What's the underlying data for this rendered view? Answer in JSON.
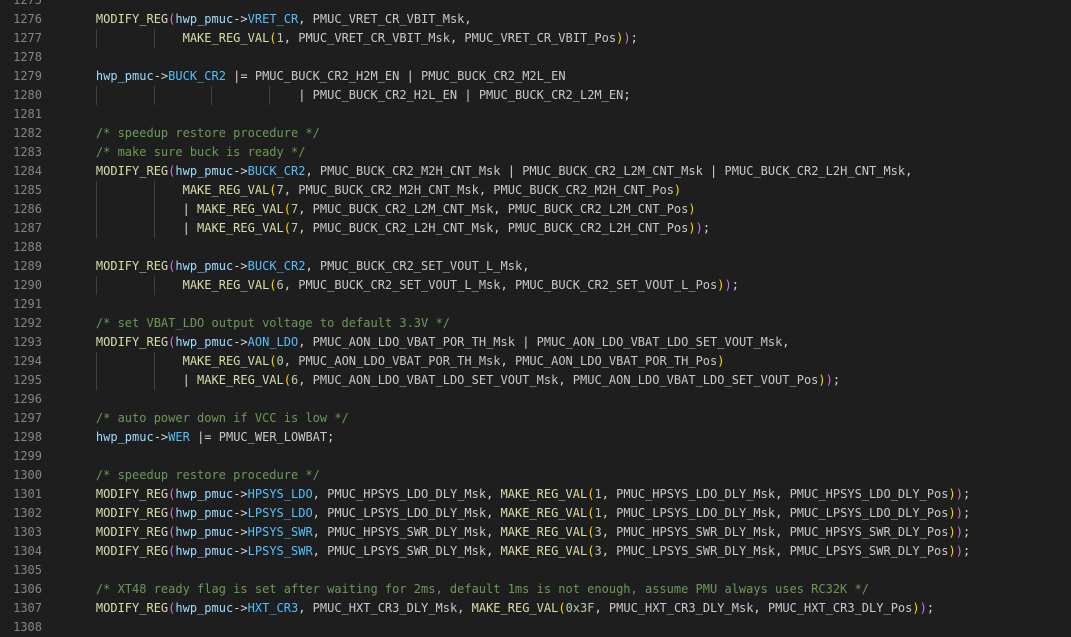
{
  "editor": {
    "lines": [
      {
        "no": "1275",
        "tokens": []
      },
      {
        "no": "1276",
        "tokens": [
          [
            "ws",
            "    "
          ],
          [
            "macro",
            "MODIFY_REG"
          ],
          [
            "p1",
            "("
          ],
          [
            "var",
            "hwp_pmuc"
          ],
          [
            "op",
            "->"
          ],
          [
            "field",
            "VRET_CR"
          ],
          [
            "op",
            ", "
          ],
          [
            "const",
            "PMUC_VRET_CR_VBIT_Msk"
          ],
          [
            "op",
            ","
          ]
        ]
      },
      {
        "no": "1277",
        "tokens": [
          [
            "ws",
            "                "
          ],
          [
            "macro",
            "MAKE_REG_VAL"
          ],
          [
            "p2",
            "("
          ],
          [
            "num",
            "1"
          ],
          [
            "op",
            ", "
          ],
          [
            "const",
            "PMUC_VRET_CR_VBIT_Msk"
          ],
          [
            "op",
            ", "
          ],
          [
            "const",
            "PMUC_VRET_CR_VBIT_Pos"
          ],
          [
            "p2",
            ")"
          ],
          [
            "p1",
            ")"
          ],
          [
            "op",
            ";"
          ]
        ]
      },
      {
        "no": "1278",
        "tokens": []
      },
      {
        "no": "1279",
        "tokens": [
          [
            "ws",
            "    "
          ],
          [
            "var",
            "hwp_pmuc"
          ],
          [
            "op",
            "->"
          ],
          [
            "field",
            "BUCK_CR2"
          ],
          [
            "op",
            " |= "
          ],
          [
            "const",
            "PMUC_BUCK_CR2_H2M_EN"
          ],
          [
            "op",
            " | "
          ],
          [
            "const",
            "PMUC_BUCK_CR2_M2L_EN"
          ]
        ]
      },
      {
        "no": "1280",
        "tokens": [
          [
            "ws",
            "                                "
          ],
          [
            "op",
            "| "
          ],
          [
            "const",
            "PMUC_BUCK_CR2_H2L_EN"
          ],
          [
            "op",
            " | "
          ],
          [
            "const",
            "PMUC_BUCK_CR2_L2M_EN"
          ],
          [
            "op",
            ";"
          ]
        ]
      },
      {
        "no": "1281",
        "tokens": []
      },
      {
        "no": "1282",
        "tokens": [
          [
            "ws",
            "    "
          ],
          [
            "comment",
            "/* speedup restore procedure */"
          ]
        ]
      },
      {
        "no": "1283",
        "tokens": [
          [
            "ws",
            "    "
          ],
          [
            "comment",
            "/* make sure buck is ready */"
          ]
        ]
      },
      {
        "no": "1284",
        "tokens": [
          [
            "ws",
            "    "
          ],
          [
            "macro",
            "MODIFY_REG"
          ],
          [
            "p1",
            "("
          ],
          [
            "var",
            "hwp_pmuc"
          ],
          [
            "op",
            "->"
          ],
          [
            "field",
            "BUCK_CR2"
          ],
          [
            "op",
            ", "
          ],
          [
            "const",
            "PMUC_BUCK_CR2_M2H_CNT_Msk"
          ],
          [
            "op",
            " | "
          ],
          [
            "const",
            "PMUC_BUCK_CR2_L2M_CNT_Msk"
          ],
          [
            "op",
            " | "
          ],
          [
            "const",
            "PMUC_BUCK_CR2_L2H_CNT_Msk"
          ],
          [
            "op",
            ","
          ]
        ]
      },
      {
        "no": "1285",
        "tokens": [
          [
            "ws",
            "                "
          ],
          [
            "macro",
            "MAKE_REG_VAL"
          ],
          [
            "p2",
            "("
          ],
          [
            "num",
            "7"
          ],
          [
            "op",
            ", "
          ],
          [
            "const",
            "PMUC_BUCK_CR2_M2H_CNT_Msk"
          ],
          [
            "op",
            ", "
          ],
          [
            "const",
            "PMUC_BUCK_CR2_M2H_CNT_Pos"
          ],
          [
            "p2",
            ")"
          ]
        ]
      },
      {
        "no": "1286",
        "tokens": [
          [
            "ws",
            "                "
          ],
          [
            "op",
            "| "
          ],
          [
            "macro",
            "MAKE_REG_VAL"
          ],
          [
            "p2",
            "("
          ],
          [
            "num",
            "7"
          ],
          [
            "op",
            ", "
          ],
          [
            "const",
            "PMUC_BUCK_CR2_L2M_CNT_Msk"
          ],
          [
            "op",
            ", "
          ],
          [
            "const",
            "PMUC_BUCK_CR2_L2M_CNT_Pos"
          ],
          [
            "p2",
            ")"
          ]
        ]
      },
      {
        "no": "1287",
        "tokens": [
          [
            "ws",
            "                "
          ],
          [
            "op",
            "| "
          ],
          [
            "macro",
            "MAKE_REG_VAL"
          ],
          [
            "p2",
            "("
          ],
          [
            "num",
            "7"
          ],
          [
            "op",
            ", "
          ],
          [
            "const",
            "PMUC_BUCK_CR2_L2H_CNT_Msk"
          ],
          [
            "op",
            ", "
          ],
          [
            "const",
            "PMUC_BUCK_CR2_L2H_CNT_Pos"
          ],
          [
            "p2",
            ")"
          ],
          [
            "p1",
            ")"
          ],
          [
            "op",
            ";"
          ]
        ]
      },
      {
        "no": "1288",
        "tokens": []
      },
      {
        "no": "1289",
        "tokens": [
          [
            "ws",
            "    "
          ],
          [
            "macro",
            "MODIFY_REG"
          ],
          [
            "p1",
            "("
          ],
          [
            "var",
            "hwp_pmuc"
          ],
          [
            "op",
            "->"
          ],
          [
            "field",
            "BUCK_CR2"
          ],
          [
            "op",
            ", "
          ],
          [
            "const",
            "PMUC_BUCK_CR2_SET_VOUT_L_Msk"
          ],
          [
            "op",
            ","
          ]
        ]
      },
      {
        "no": "1290",
        "tokens": [
          [
            "ws",
            "                "
          ],
          [
            "macro",
            "MAKE_REG_VAL"
          ],
          [
            "p2",
            "("
          ],
          [
            "num",
            "6"
          ],
          [
            "op",
            ", "
          ],
          [
            "const",
            "PMUC_BUCK_CR2_SET_VOUT_L_Msk"
          ],
          [
            "op",
            ", "
          ],
          [
            "const",
            "PMUC_BUCK_CR2_SET_VOUT_L_Pos"
          ],
          [
            "p2",
            ")"
          ],
          [
            "p1",
            ")"
          ],
          [
            "op",
            ";"
          ]
        ]
      },
      {
        "no": "1291",
        "tokens": []
      },
      {
        "no": "1292",
        "tokens": [
          [
            "ws",
            "    "
          ],
          [
            "comment",
            "/* set VBAT_LDO output voltage to default 3.3V */"
          ]
        ]
      },
      {
        "no": "1293",
        "tokens": [
          [
            "ws",
            "    "
          ],
          [
            "macro",
            "MODIFY_REG"
          ],
          [
            "p1",
            "("
          ],
          [
            "var",
            "hwp_pmuc"
          ],
          [
            "op",
            "->"
          ],
          [
            "field",
            "AON_LDO"
          ],
          [
            "op",
            ", "
          ],
          [
            "const",
            "PMUC_AON_LDO_VBAT_POR_TH_Msk"
          ],
          [
            "op",
            " | "
          ],
          [
            "const",
            "PMUC_AON_LDO_VBAT_LDO_SET_VOUT_Msk"
          ],
          [
            "op",
            ","
          ]
        ]
      },
      {
        "no": "1294",
        "tokens": [
          [
            "ws",
            "                "
          ],
          [
            "macro",
            "MAKE_REG_VAL"
          ],
          [
            "p2",
            "("
          ],
          [
            "num",
            "0"
          ],
          [
            "op",
            ", "
          ],
          [
            "const",
            "PMUC_AON_LDO_VBAT_POR_TH_Msk"
          ],
          [
            "op",
            ", "
          ],
          [
            "const",
            "PMUC_AON_LDO_VBAT_POR_TH_Pos"
          ],
          [
            "p2",
            ")"
          ]
        ]
      },
      {
        "no": "1295",
        "tokens": [
          [
            "ws",
            "                "
          ],
          [
            "op",
            "| "
          ],
          [
            "macro",
            "MAKE_REG_VAL"
          ],
          [
            "p2",
            "("
          ],
          [
            "num",
            "6"
          ],
          [
            "op",
            ", "
          ],
          [
            "const",
            "PMUC_AON_LDO_VBAT_LDO_SET_VOUT_Msk"
          ],
          [
            "op",
            ", "
          ],
          [
            "const",
            "PMUC_AON_LDO_VBAT_LDO_SET_VOUT_Pos"
          ],
          [
            "p2",
            ")"
          ],
          [
            "p1",
            ")"
          ],
          [
            "op",
            ";"
          ]
        ]
      },
      {
        "no": "1296",
        "tokens": []
      },
      {
        "no": "1297",
        "tokens": [
          [
            "ws",
            "    "
          ],
          [
            "comment",
            "/* auto power down if VCC is low */"
          ]
        ]
      },
      {
        "no": "1298",
        "tokens": [
          [
            "ws",
            "    "
          ],
          [
            "var",
            "hwp_pmuc"
          ],
          [
            "op",
            "->"
          ],
          [
            "field",
            "WER"
          ],
          [
            "op",
            " |= "
          ],
          [
            "const",
            "PMUC_WER_LOWBAT"
          ],
          [
            "op",
            ";"
          ]
        ]
      },
      {
        "no": "1299",
        "tokens": []
      },
      {
        "no": "1300",
        "tokens": [
          [
            "ws",
            "    "
          ],
          [
            "comment",
            "/* speedup restore procedure */"
          ]
        ]
      },
      {
        "no": "1301",
        "tokens": [
          [
            "ws",
            "    "
          ],
          [
            "macro",
            "MODIFY_REG"
          ],
          [
            "p1",
            "("
          ],
          [
            "var",
            "hwp_pmuc"
          ],
          [
            "op",
            "->"
          ],
          [
            "field",
            "HPSYS_LDO"
          ],
          [
            "op",
            ", "
          ],
          [
            "const",
            "PMUC_HPSYS_LDO_DLY_Msk"
          ],
          [
            "op",
            ", "
          ],
          [
            "macro",
            "MAKE_REG_VAL"
          ],
          [
            "p2",
            "("
          ],
          [
            "num",
            "1"
          ],
          [
            "op",
            ", "
          ],
          [
            "const",
            "PMUC_HPSYS_LDO_DLY_Msk"
          ],
          [
            "op",
            ", "
          ],
          [
            "const",
            "PMUC_HPSYS_LDO_DLY_Pos"
          ],
          [
            "p2",
            ")"
          ],
          [
            "p1",
            ")"
          ],
          [
            "op",
            ";"
          ]
        ]
      },
      {
        "no": "1302",
        "tokens": [
          [
            "ws",
            "    "
          ],
          [
            "macro",
            "MODIFY_REG"
          ],
          [
            "p1",
            "("
          ],
          [
            "var",
            "hwp_pmuc"
          ],
          [
            "op",
            "->"
          ],
          [
            "field",
            "LPSYS_LDO"
          ],
          [
            "op",
            ", "
          ],
          [
            "const",
            "PMUC_LPSYS_LDO_DLY_Msk"
          ],
          [
            "op",
            ", "
          ],
          [
            "macro",
            "MAKE_REG_VAL"
          ],
          [
            "p2",
            "("
          ],
          [
            "num",
            "1"
          ],
          [
            "op",
            ", "
          ],
          [
            "const",
            "PMUC_LPSYS_LDO_DLY_Msk"
          ],
          [
            "op",
            ", "
          ],
          [
            "const",
            "PMUC_LPSYS_LDO_DLY_Pos"
          ],
          [
            "p2",
            ")"
          ],
          [
            "p1",
            ")"
          ],
          [
            "op",
            ";"
          ]
        ]
      },
      {
        "no": "1303",
        "tokens": [
          [
            "ws",
            "    "
          ],
          [
            "macro",
            "MODIFY_REG"
          ],
          [
            "p1",
            "("
          ],
          [
            "var",
            "hwp_pmuc"
          ],
          [
            "op",
            "->"
          ],
          [
            "field",
            "HPSYS_SWR"
          ],
          [
            "op",
            ", "
          ],
          [
            "const",
            "PMUC_HPSYS_SWR_DLY_Msk"
          ],
          [
            "op",
            ", "
          ],
          [
            "macro",
            "MAKE_REG_VAL"
          ],
          [
            "p2",
            "("
          ],
          [
            "num",
            "3"
          ],
          [
            "op",
            ", "
          ],
          [
            "const",
            "PMUC_HPSYS_SWR_DLY_Msk"
          ],
          [
            "op",
            ", "
          ],
          [
            "const",
            "PMUC_HPSYS_SWR_DLY_Pos"
          ],
          [
            "p2",
            ")"
          ],
          [
            "p1",
            ")"
          ],
          [
            "op",
            ";"
          ]
        ]
      },
      {
        "no": "1304",
        "tokens": [
          [
            "ws",
            "    "
          ],
          [
            "macro",
            "MODIFY_REG"
          ],
          [
            "p1",
            "("
          ],
          [
            "var",
            "hwp_pmuc"
          ],
          [
            "op",
            "->"
          ],
          [
            "field",
            "LPSYS_SWR"
          ],
          [
            "op",
            ", "
          ],
          [
            "const",
            "PMUC_LPSYS_SWR_DLY_Msk"
          ],
          [
            "op",
            ", "
          ],
          [
            "macro",
            "MAKE_REG_VAL"
          ],
          [
            "p2",
            "("
          ],
          [
            "num",
            "3"
          ],
          [
            "op",
            ", "
          ],
          [
            "const",
            "PMUC_LPSYS_SWR_DLY_Msk"
          ],
          [
            "op",
            ", "
          ],
          [
            "const",
            "PMUC_LPSYS_SWR_DLY_Pos"
          ],
          [
            "p2",
            ")"
          ],
          [
            "p1",
            ")"
          ],
          [
            "op",
            ";"
          ]
        ]
      },
      {
        "no": "1305",
        "tokens": []
      },
      {
        "no": "1306",
        "tokens": [
          [
            "ws",
            "    "
          ],
          [
            "comment",
            "/* XT48 ready flag is set after waiting for 2ms, default 1ms is not enough, assume PMU always uses RC32K */"
          ]
        ]
      },
      {
        "no": "1307",
        "tokens": [
          [
            "ws",
            "    "
          ],
          [
            "macro",
            "MODIFY_REG"
          ],
          [
            "p1",
            "("
          ],
          [
            "var",
            "hwp_pmuc"
          ],
          [
            "op",
            "->"
          ],
          [
            "field",
            "HXT_CR3"
          ],
          [
            "op",
            ", "
          ],
          [
            "const",
            "PMUC_HXT_CR3_DLY_Msk"
          ],
          [
            "op",
            ", "
          ],
          [
            "macro",
            "MAKE_REG_VAL"
          ],
          [
            "p2",
            "("
          ],
          [
            "num",
            "0x3F"
          ],
          [
            "op",
            ", "
          ],
          [
            "const",
            "PMUC_HXT_CR3_DLY_Msk"
          ],
          [
            "op",
            ", "
          ],
          [
            "const",
            "PMUC_HXT_CR3_DLY_Pos"
          ],
          [
            "p2",
            ")"
          ],
          [
            "p1",
            ")"
          ],
          [
            "op",
            ";"
          ]
        ]
      },
      {
        "no": "1308",
        "tokens": []
      }
    ]
  }
}
